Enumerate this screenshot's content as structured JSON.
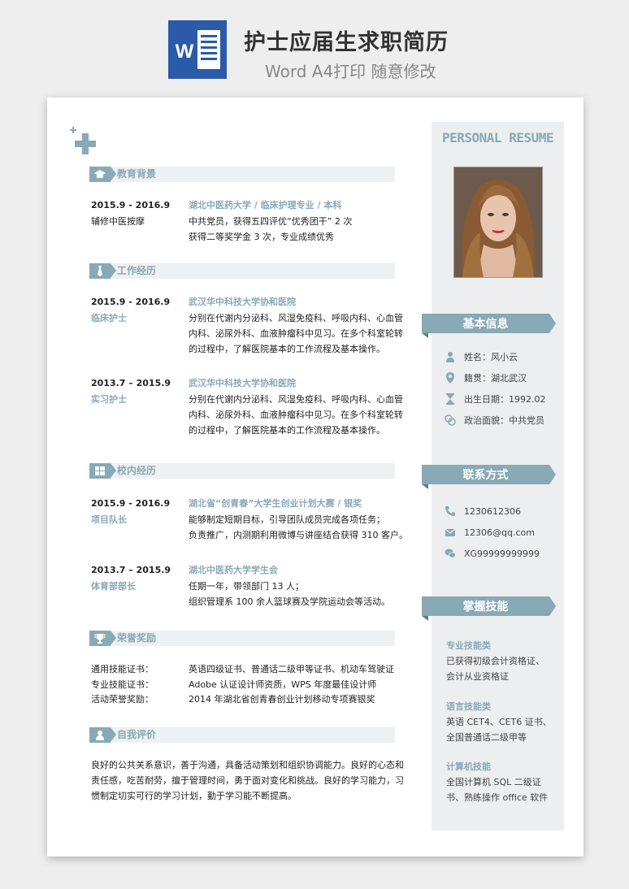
{
  "header": {
    "title": "护士应届生求职简历",
    "subtitle": "Word A4打印 随意修改",
    "icon": "word-icon"
  },
  "colors": {
    "accent": "#88a9b6",
    "dark": "#222222"
  },
  "education": {
    "title": "教育背景",
    "date": "2015.9 - 2016.9",
    "sub": "辅修中医按摩",
    "headline": "湖北中医药大学 / 临床护理专业 / 本科",
    "lines": [
      "中共党员，获得五四评优“优秀团干”  2 次",
      "获得二等奖学金 3 次，专业成绩优秀"
    ]
  },
  "work": {
    "title": "工作经历",
    "items": [
      {
        "date": "2015.9 - 2016.9",
        "role": "临床护士",
        "org": "武汉华中科技大学协和医院",
        "lines": [
          "分别在代谢内分泌科、风湿免疫科、呼吸内科、心血管",
          "内科、泌尿外科、血液肿瘤科中见习。在多个科室轮转",
          "的过程中，了解医院基本的工作流程及基本操作。"
        ]
      },
      {
        "date": "2013.7 – 2015.9",
        "role": "实习护士",
        "org": "武汉华中科技大学协和医院",
        "lines": [
          "分别在代谢内分泌科、风湿免疫科、呼吸内科、心血管",
          "内科、泌尿外科、血液肿瘤科中见习。在多个科室轮转",
          "的过程中，了解医院基本的工作流程及基本操作。"
        ]
      }
    ]
  },
  "campus": {
    "title": "校内经历",
    "items": [
      {
        "date": "2015.9 - 2016.9",
        "role": "项目队长",
        "org": "湖北省“创青春”大学生创业计划大赛 / 银奖",
        "lines": [
          "能够制定短期目标，引导团队成员完成各项任务；",
          "负责推广，内测期利用微博与讲座结合获得 310 客户。"
        ]
      },
      {
        "date": "2013.7 – 2015.9",
        "role": "体育部部长",
        "org": "湖北中医药大学学生会",
        "lines": [
          "任期一年，带领部门 13 人；",
          "组织管理系 100 余人篮球赛及学院运动会等活动。"
        ]
      }
    ]
  },
  "awards": {
    "title": "荣誉奖励",
    "rows": [
      {
        "label": "通用技能证书：",
        "value": "英语四级证书、普通话二级甲等证书、机动车驾驶证"
      },
      {
        "label": "专业技能证书：",
        "value": "Adobe 认证设计师资质，WPS 年度最佳设计师"
      },
      {
        "label": "活动荣誉奖励：",
        "value": "2014 年湖北省创青春创业计划移动专项赛银奖"
      }
    ]
  },
  "self": {
    "title": "自我评价",
    "lines": [
      "良好的公共关系意识，善于沟通，具备活动策划和组织协调能力。良好的心态和",
      "责任感，吃苦耐劳，擅于管理时间，勇于面对变化和挑战。良好的学习能力，习",
      "惯制定切实可行的学习计划，勤于学习能不断提高。"
    ]
  },
  "sidebar": {
    "resume_title": "PERSONAL RESUME",
    "basic": {
      "title": "基本信息",
      "items": [
        {
          "icon": "person-icon",
          "text": "姓名：风小云"
        },
        {
          "icon": "location-icon",
          "text": "籍贯：湖北武汉"
        },
        {
          "icon": "hourglass-icon",
          "text": "出生日期：1992.02"
        },
        {
          "icon": "people-icon",
          "text": "政治面貌：中共党员"
        }
      ]
    },
    "contact": {
      "title": "联系方式",
      "items": [
        {
          "icon": "phone-icon",
          "text": "1230612306"
        },
        {
          "icon": "mail-icon",
          "text": "12306@qq.com"
        },
        {
          "icon": "wechat-icon",
          "text": "XG99999999999"
        }
      ]
    },
    "skills": {
      "title": "掌握技能",
      "groups": [
        {
          "name": "专业技能类",
          "lines": [
            "已获得初级会计资格证、",
            "会计从业资格证"
          ]
        },
        {
          "name": "语言技能类",
          "lines": [
            "英语 CET4、CET6 证书、",
            "全国普通话二级甲等"
          ]
        },
        {
          "name": "计算机技能",
          "lines": [
            "全国计算机  SQL  二级证",
            "书、熟练操作 office 软件"
          ]
        }
      ]
    }
  }
}
